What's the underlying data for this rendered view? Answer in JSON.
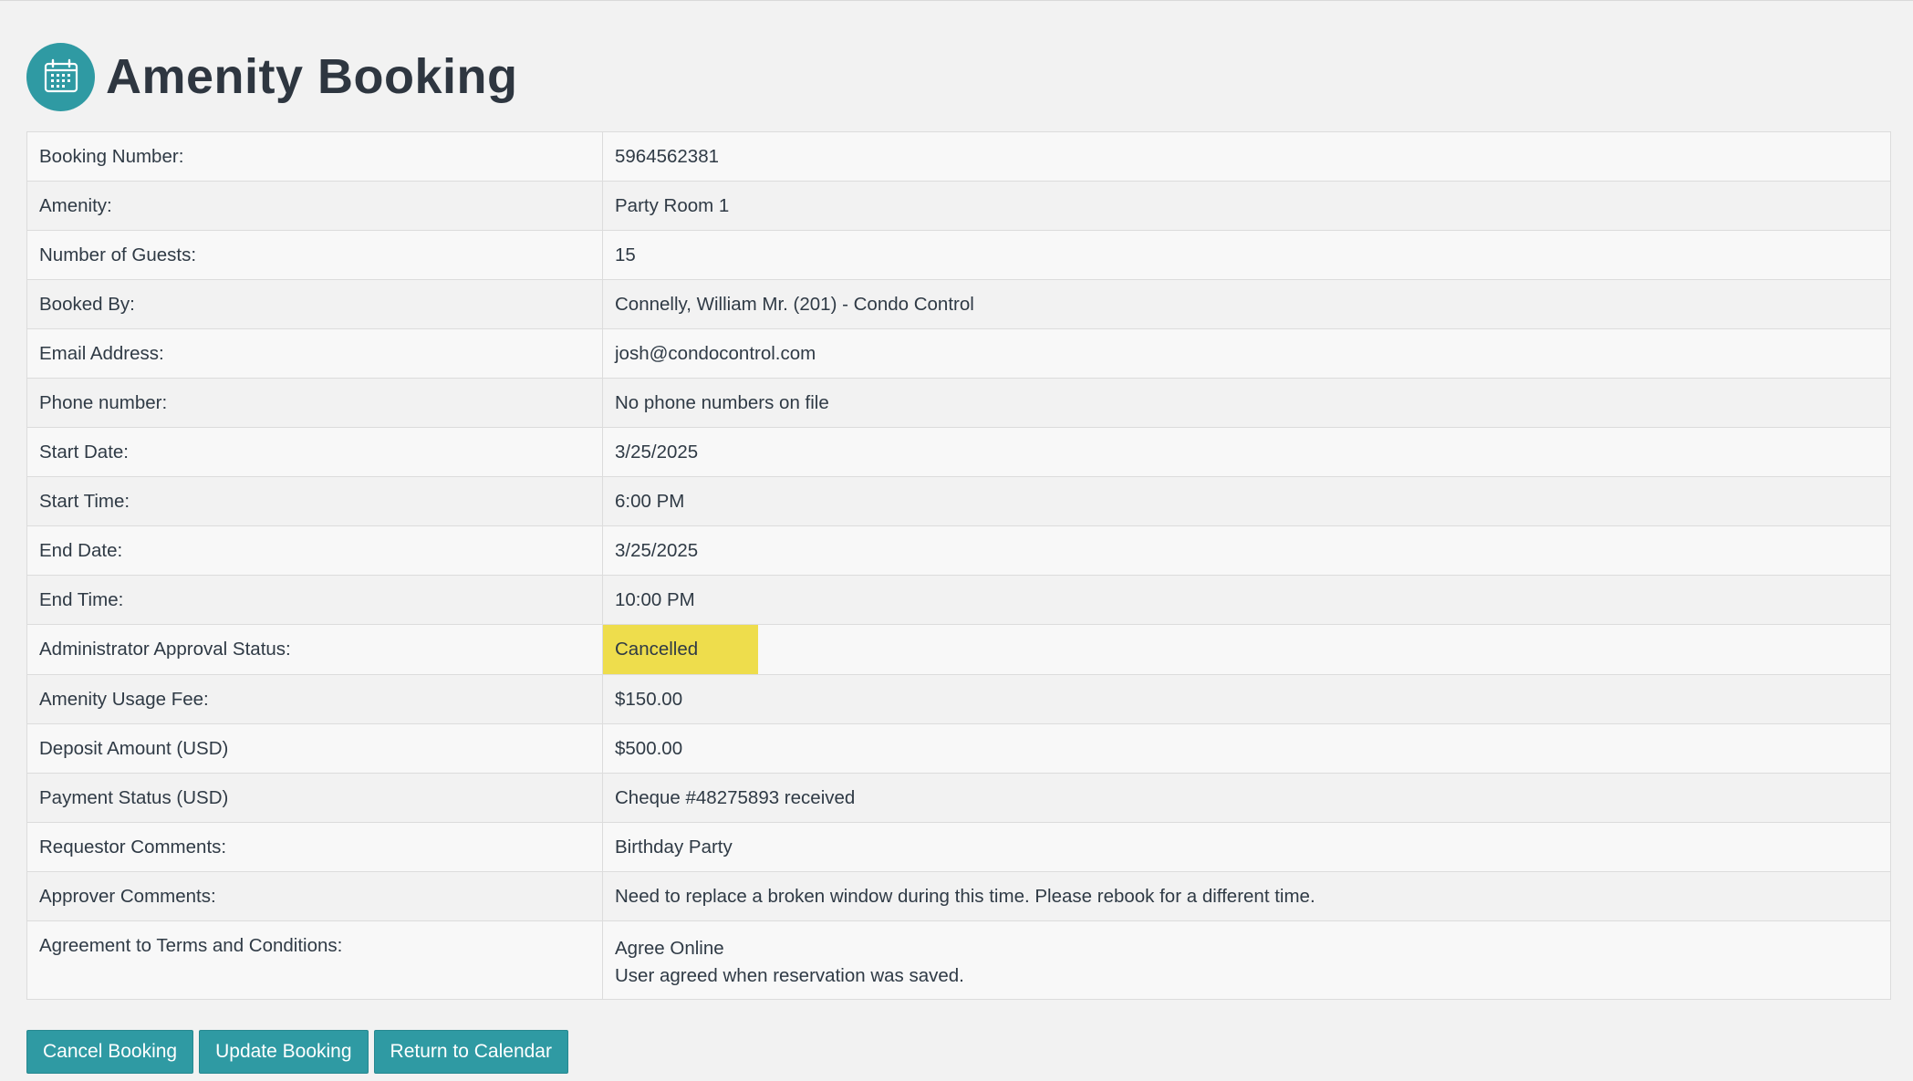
{
  "header": {
    "title": "Amenity Booking",
    "icon": "calendar-icon",
    "icon_bg_color": "#2f9aa3"
  },
  "details": {
    "booking_number": {
      "label": "Booking Number:",
      "value": "5964562381"
    },
    "amenity": {
      "label": "Amenity:",
      "value": "Party Room 1"
    },
    "guests": {
      "label": "Number of Guests:",
      "value": "15"
    },
    "booked_by": {
      "label": "Booked By:",
      "value": "Connelly, William Mr. (201) - Condo Control"
    },
    "email": {
      "label": "Email Address:",
      "value": "josh@condocontrol.com"
    },
    "phone": {
      "label": "Phone number:",
      "value": "No phone numbers on file"
    },
    "start_date": {
      "label": "Start Date:",
      "value": "3/25/2025"
    },
    "start_time": {
      "label": "Start Time:",
      "value": "6:00 PM"
    },
    "end_date": {
      "label": "End Date:",
      "value": "3/25/2025"
    },
    "end_time": {
      "label": "End Time:",
      "value": "10:00 PM"
    },
    "approval_status": {
      "label": "Administrator Approval Status:",
      "value": "Cancelled",
      "highlight_color": "#eedd4c"
    },
    "usage_fee": {
      "label": "Amenity Usage Fee:",
      "value": "$150.00"
    },
    "deposit": {
      "label": "Deposit Amount (USD)",
      "value": "$500.00"
    },
    "payment_status": {
      "label": "Payment Status (USD)",
      "value": "Cheque #48275893 received"
    },
    "requestor_comments": {
      "label": "Requestor Comments:",
      "value": "Birthday Party"
    },
    "approver_comments": {
      "label": "Approver Comments:",
      "value": "Need to replace a broken window during this time. Please rebook for a different time."
    },
    "terms": {
      "label": "Agreement to Terms and Conditions:",
      "value_line1": "Agree Online",
      "value_line2": "User agreed when reservation was saved."
    }
  },
  "actions": {
    "cancel_label": "Cancel Booking",
    "update_label": "Update Booking",
    "return_label": "Return to Calendar",
    "button_color": "#2f9aa3"
  }
}
